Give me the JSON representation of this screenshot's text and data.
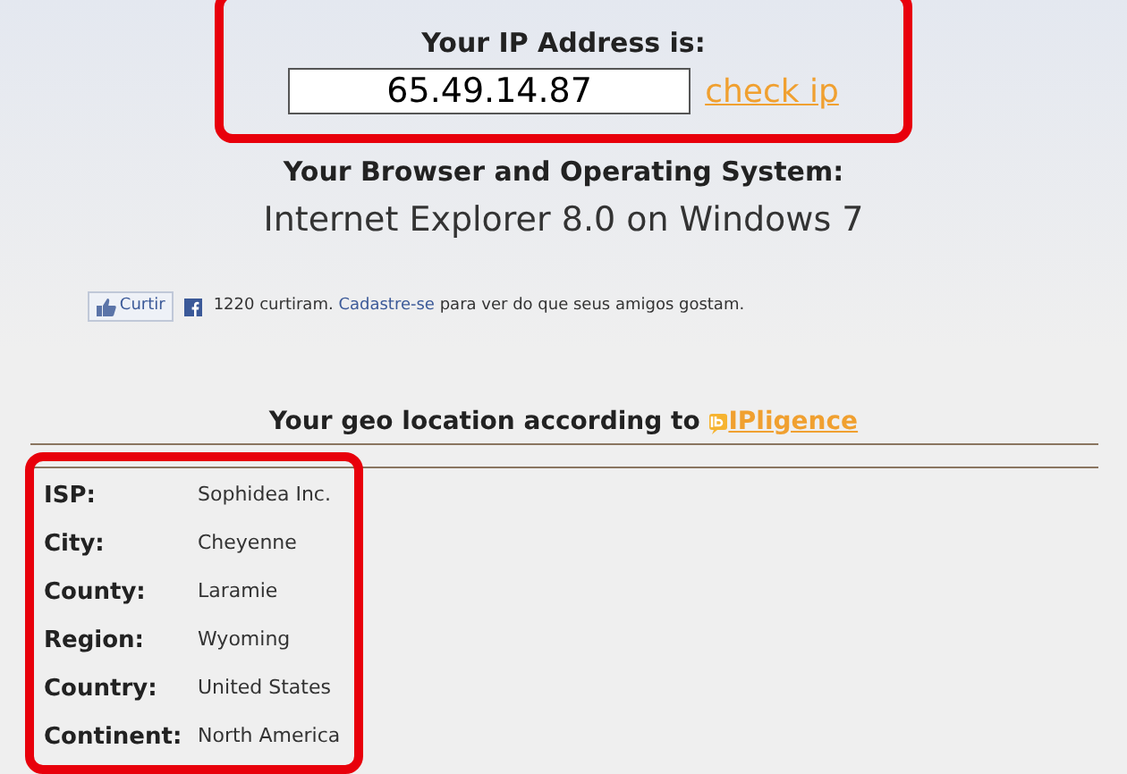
{
  "ip_section": {
    "heading": "Your IP Address is:",
    "ip_value": "65.49.14.87",
    "link": "check ip"
  },
  "browser_section": {
    "heading": "Your Browser and Operating System:",
    "value": "Internet Explorer 8.0 on Windows 7"
  },
  "like_bar": {
    "button": "Curtir",
    "count_text": "1220 curtiram.",
    "signup_link": "Cadastre-se",
    "rest_text": "para ver do que seus amigos gostam."
  },
  "geo_section": {
    "heading": "Your geo location according to",
    "provider_link": "IPligence",
    "rows": [
      {
        "label": "ISP:",
        "value": "Sophidea Inc."
      },
      {
        "label": "City:",
        "value": "Cheyenne"
      },
      {
        "label": "County:",
        "value": "Laramie"
      },
      {
        "label": "Region:",
        "value": "Wyoming"
      },
      {
        "label": "Country:",
        "value": "United States"
      },
      {
        "label": "Continent:",
        "value": "North America"
      }
    ]
  }
}
